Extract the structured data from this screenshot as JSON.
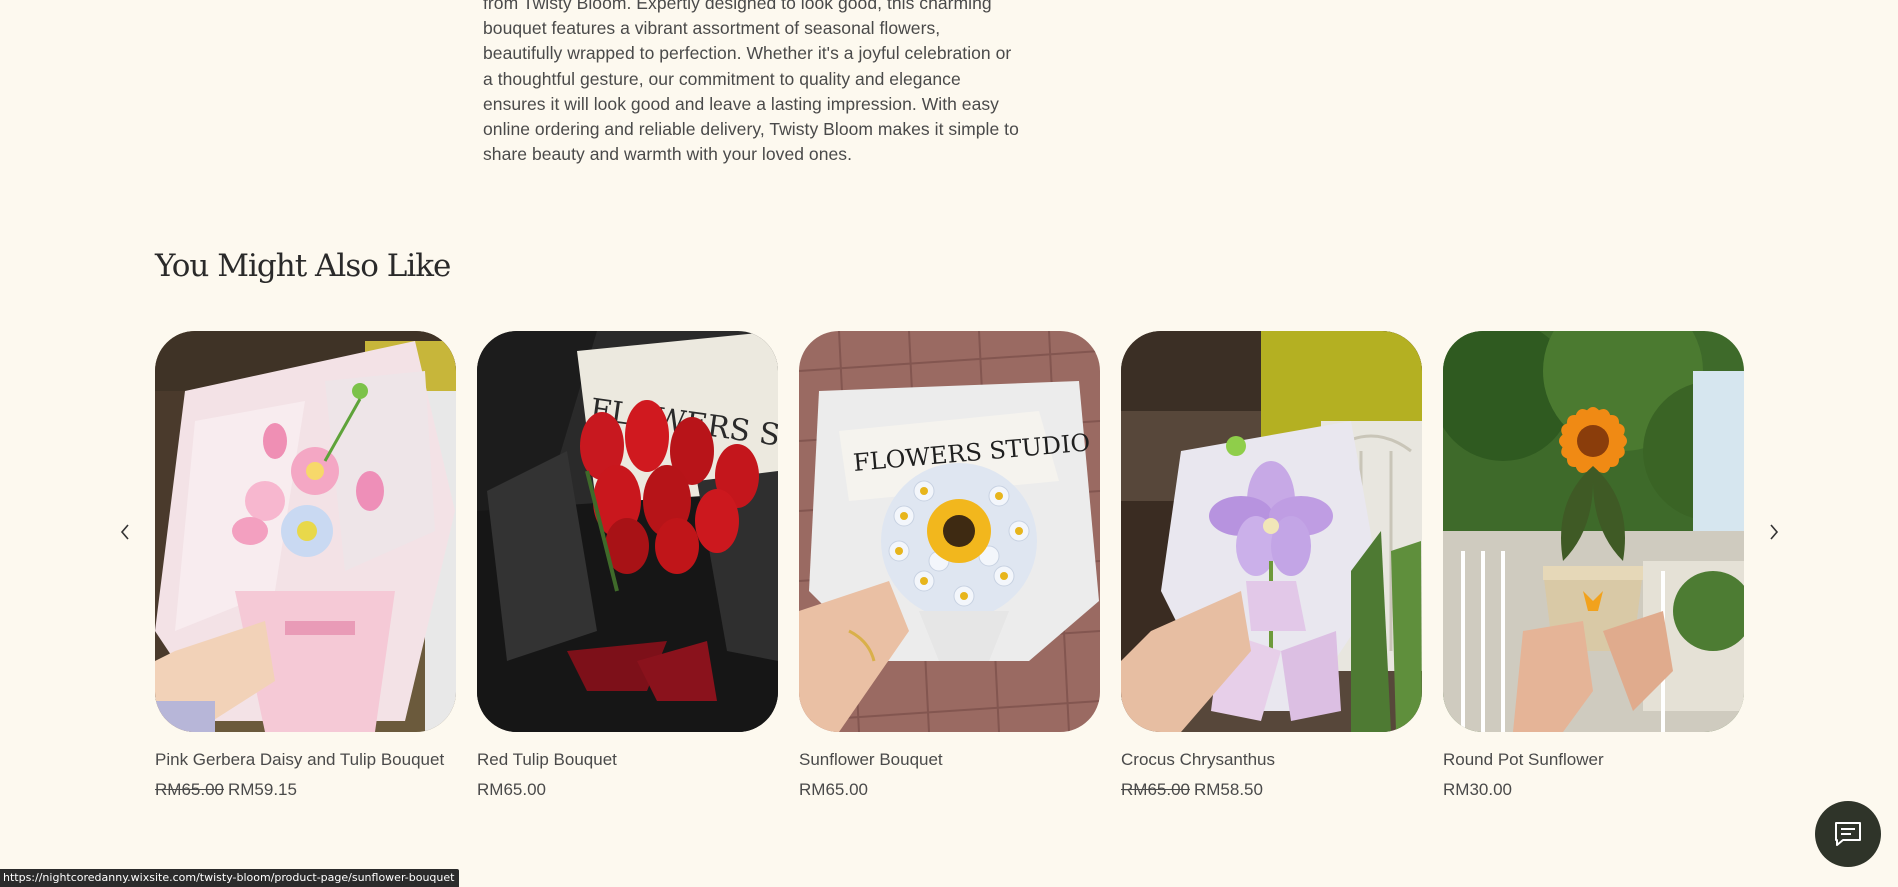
{
  "product": {
    "description": "from Twisty Bloom. Expertly designed to look good, this charming bouquet features a vibrant assortment of seasonal flowers, beautifully wrapped to perfection. Whether it's a joyful celebration or a thoughtful gesture, our commitment to quality and elegance ensures it will look good and leave a lasting impression. With easy online ordering and reliable delivery, Twisty Bloom makes it simple to share beauty and warmth with your loved ones."
  },
  "related": {
    "title": "You Might Also Like",
    "prev_icon": "chevron-left-icon",
    "next_icon": "chevron-right-icon",
    "items": [
      {
        "name": "Pink Gerbera Daisy and Tulip Bouquet",
        "price_old": "RM65.00",
        "price": "RM59.15",
        "image": "pink-bouquet-photo"
      },
      {
        "name": "Red Tulip Bouquet",
        "price_old": "",
        "price": "RM65.00",
        "image": "red-tulip-bouquet-photo"
      },
      {
        "name": "Sunflower Bouquet",
        "price_old": "",
        "price": "RM65.00",
        "image": "sunflower-bouquet-photo"
      },
      {
        "name": "Crocus Chrysanthus",
        "price_old": "RM65.00",
        "price": "RM58.50",
        "image": "crocus-bouquet-photo"
      },
      {
        "name": "Round Pot Sunflower",
        "price_old": "",
        "price": "RM30.00",
        "image": "pot-sunflower-photo"
      }
    ]
  },
  "image_text": {
    "wrap_print": "FLOWERS STUDIO"
  },
  "chat": {
    "icon": "chat-icon"
  },
  "status_bar": {
    "url": "https://nightcoredanny.wixsite.com/twisty-bloom/product-page/sunflower-bouquet"
  },
  "colors": {
    "background": "#fdf9ef",
    "text": "#4a4a4a",
    "chat_button": "#2f3429"
  }
}
